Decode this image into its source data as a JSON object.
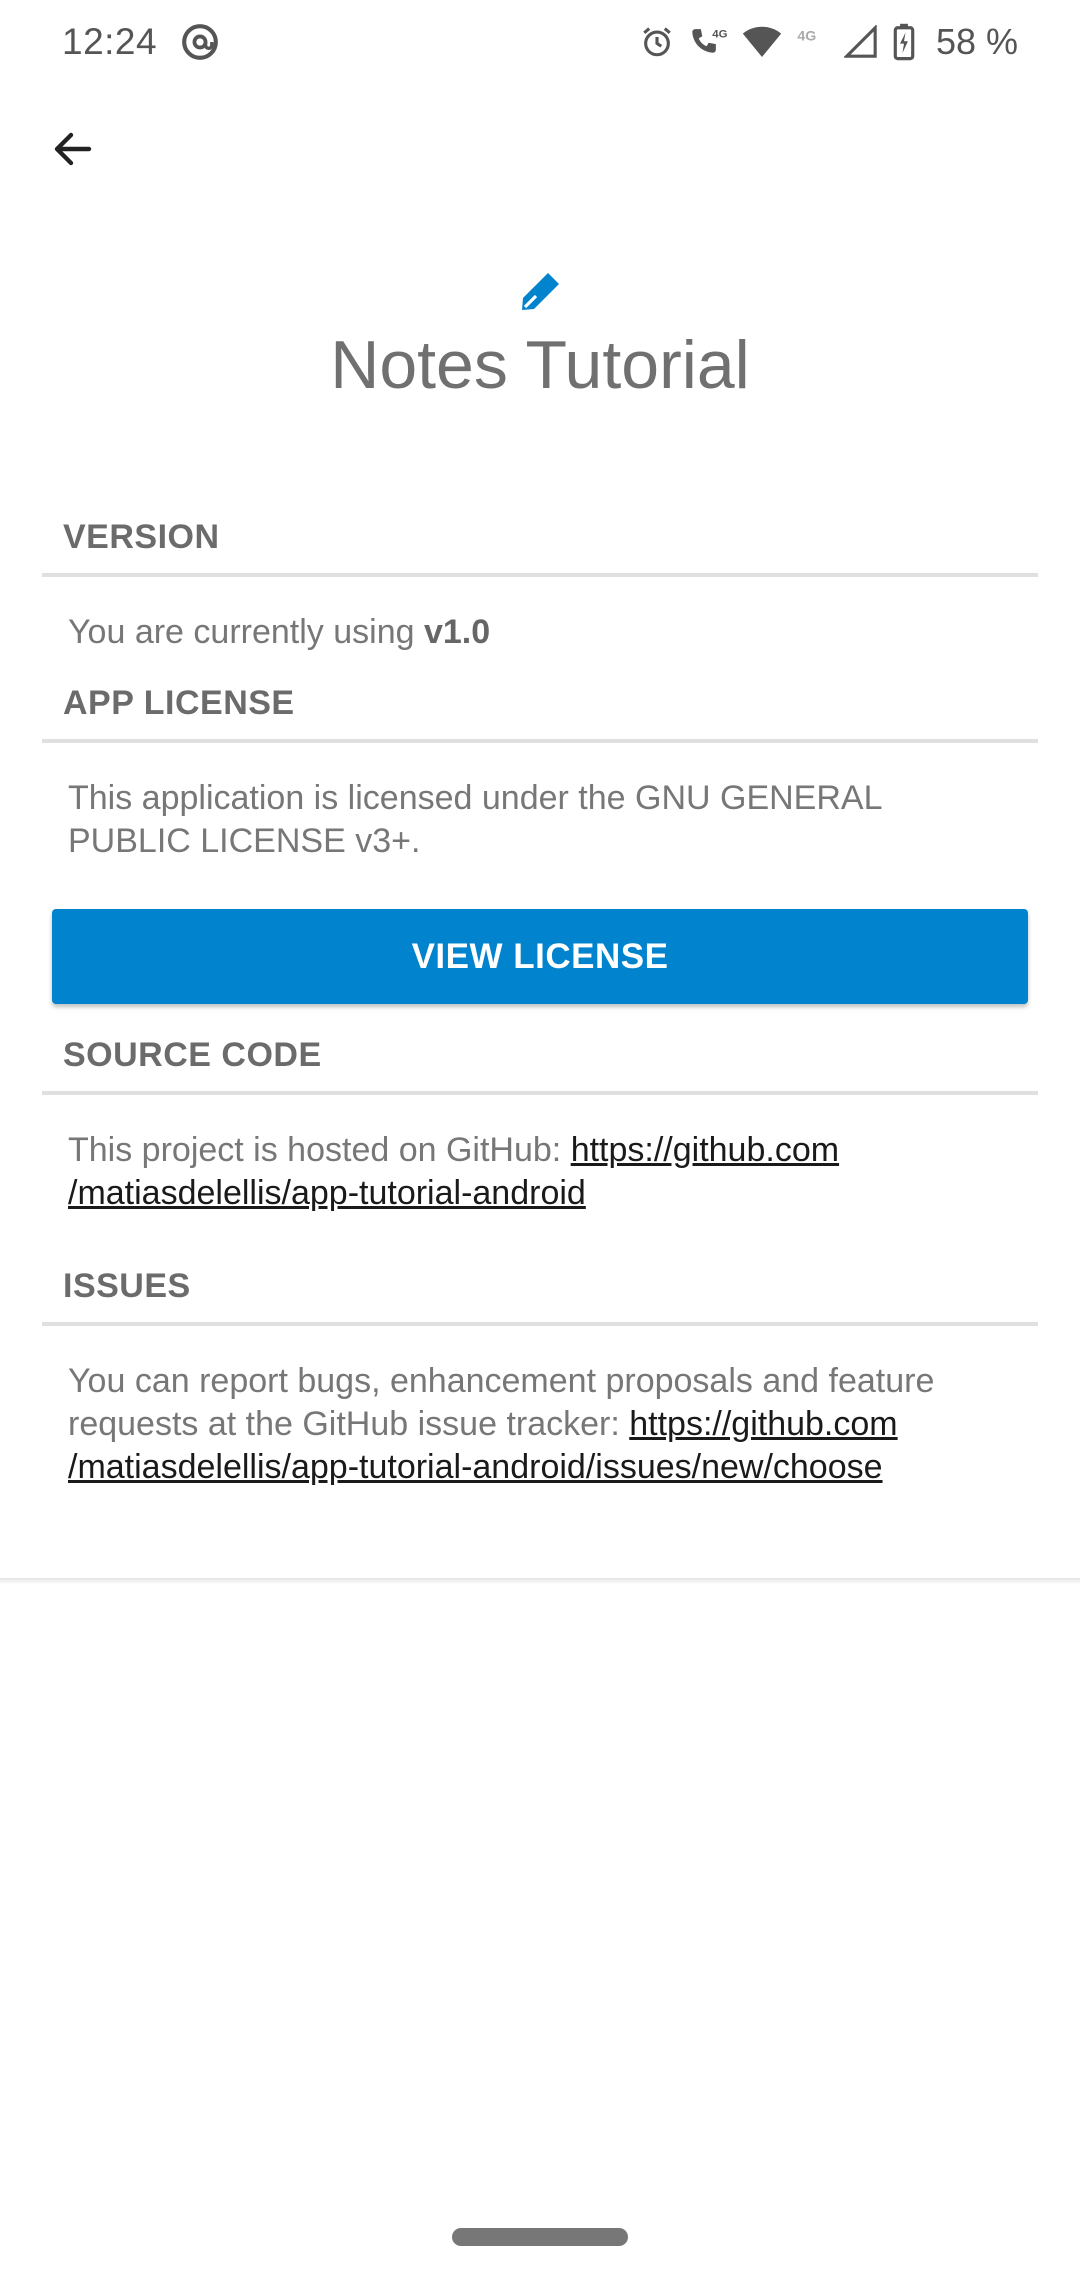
{
  "status_bar": {
    "time": "12:24",
    "battery_percent": "58 %",
    "icons": [
      "at-sign-icon",
      "alarm-icon",
      "call-4g-icon",
      "wifi-icon",
      "signal-4g-icon",
      "signal-icon",
      "battery-charging-icon"
    ]
  },
  "toolbar": {
    "back_icon": "arrow-left-icon"
  },
  "header": {
    "logo_icon": "pencil-icon",
    "title": "Notes Tutorial",
    "accent_color": "#0283cd"
  },
  "sections": {
    "version": {
      "title": "VERSION",
      "text": "You are currently using ",
      "version": "v1.0"
    },
    "license": {
      "title": "APP LICENSE",
      "text": "This application is licensed under the GNU GENERAL PUBLIC LICENSE v3+.",
      "button_label": "VIEW LICENSE"
    },
    "source": {
      "title": "SOURCE CODE",
      "text": "This project is hosted on GitHub: ",
      "link_line1": "https://github.com",
      "link_line2": "/matiasdelellis/app-tutorial-android"
    },
    "issues": {
      "title": "ISSUES",
      "text": "You can report bugs, enhancement proposals and feature requests at the GitHub issue tracker: ",
      "link_line1": "https://github.com",
      "link_line2": "/matiasdelellis/app-tutorial-android/issues/new/choose"
    }
  }
}
